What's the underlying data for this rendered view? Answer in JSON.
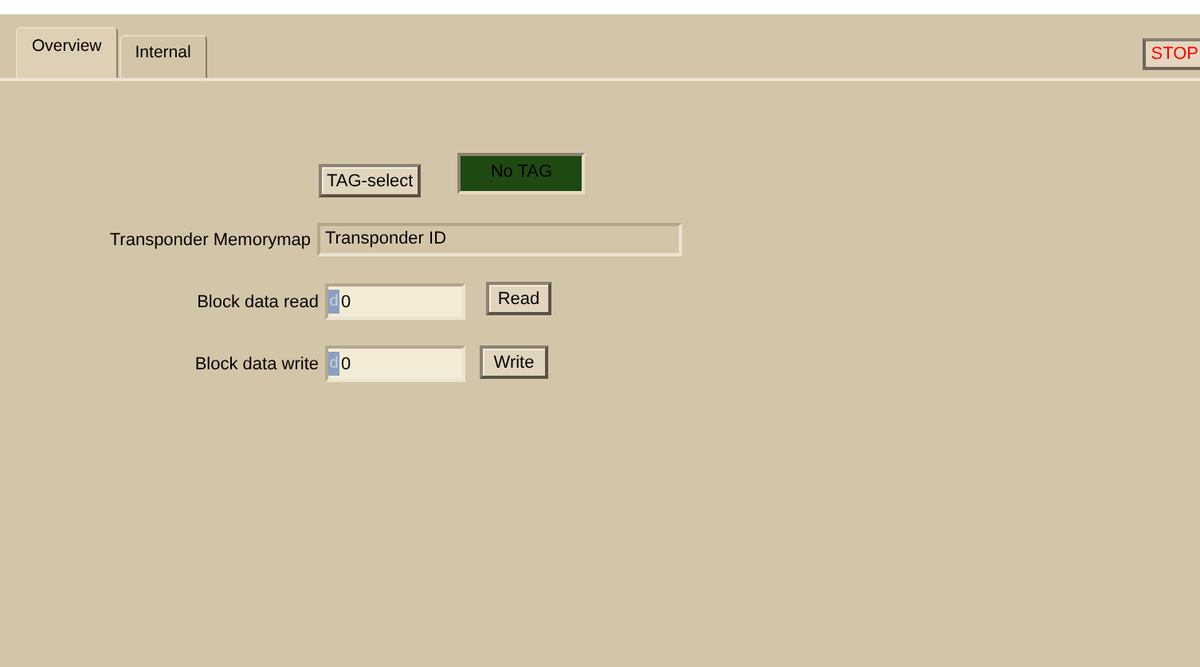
{
  "tabs": [
    {
      "label": "Overview",
      "selected": true
    },
    {
      "label": "Internal",
      "selected": false
    }
  ],
  "stop_button": {
    "label": "STOP"
  },
  "tag_select_button": {
    "label": "TAG-select"
  },
  "tag_indicator": {
    "label": "No TAG",
    "on": false
  },
  "memorymap": {
    "label": "Transponder Memorymap",
    "value": "Transponder ID"
  },
  "block_rows": [
    {
      "label": "Block data read",
      "radix": "d",
      "value": "0",
      "button": "Read"
    },
    {
      "label": "Block data write",
      "radix": "d",
      "value": "0",
      "button": "Write"
    }
  ]
}
